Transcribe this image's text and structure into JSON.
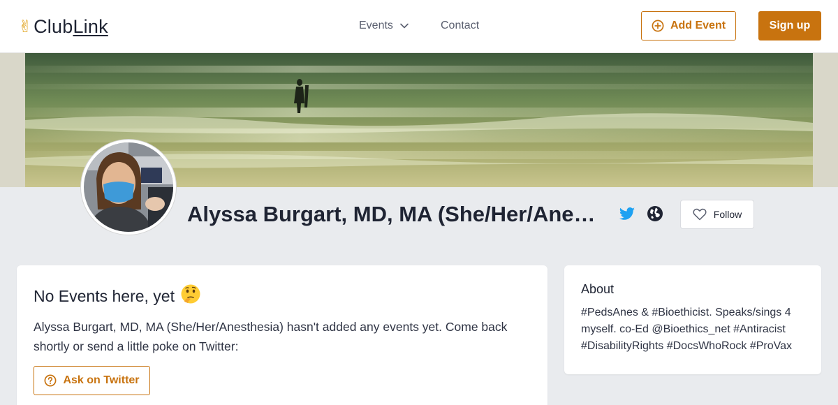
{
  "header": {
    "logo_text_a": "Club",
    "logo_text_b": "Link",
    "logo_icon": "victory-hand-icon",
    "nav": {
      "events_label": "Events",
      "contact_label": "Contact"
    },
    "add_event_label": "Add Event",
    "sign_up_label": "Sign up"
  },
  "profile": {
    "name": "Alyssa Burgart, MD, MA (She/Her/Anesthesia)",
    "follow_label": "Follow",
    "links": [
      "twitter-icon",
      "globe-icon"
    ]
  },
  "events_card": {
    "title": "No Events here, yet",
    "title_emoji": "thinking-face-icon",
    "description": "Alyssa Burgart, MD, MA (She/Her/Anesthesia) hasn't added any events yet. Come back shortly or send a little poke on Twitter:",
    "ask_button_label": "Ask on Twitter"
  },
  "about_card": {
    "title": "About",
    "text": "#PedsAnes & #Bioethicist. Speaks/sings 4 myself. co-Ed @Bioethics_net #Antiracist #DisabilityRights #DocsWhoRock #ProVax"
  },
  "colors": {
    "accent": "#c8730f",
    "twitter": "#1da1f2",
    "page_bg": "#e9ebee"
  }
}
